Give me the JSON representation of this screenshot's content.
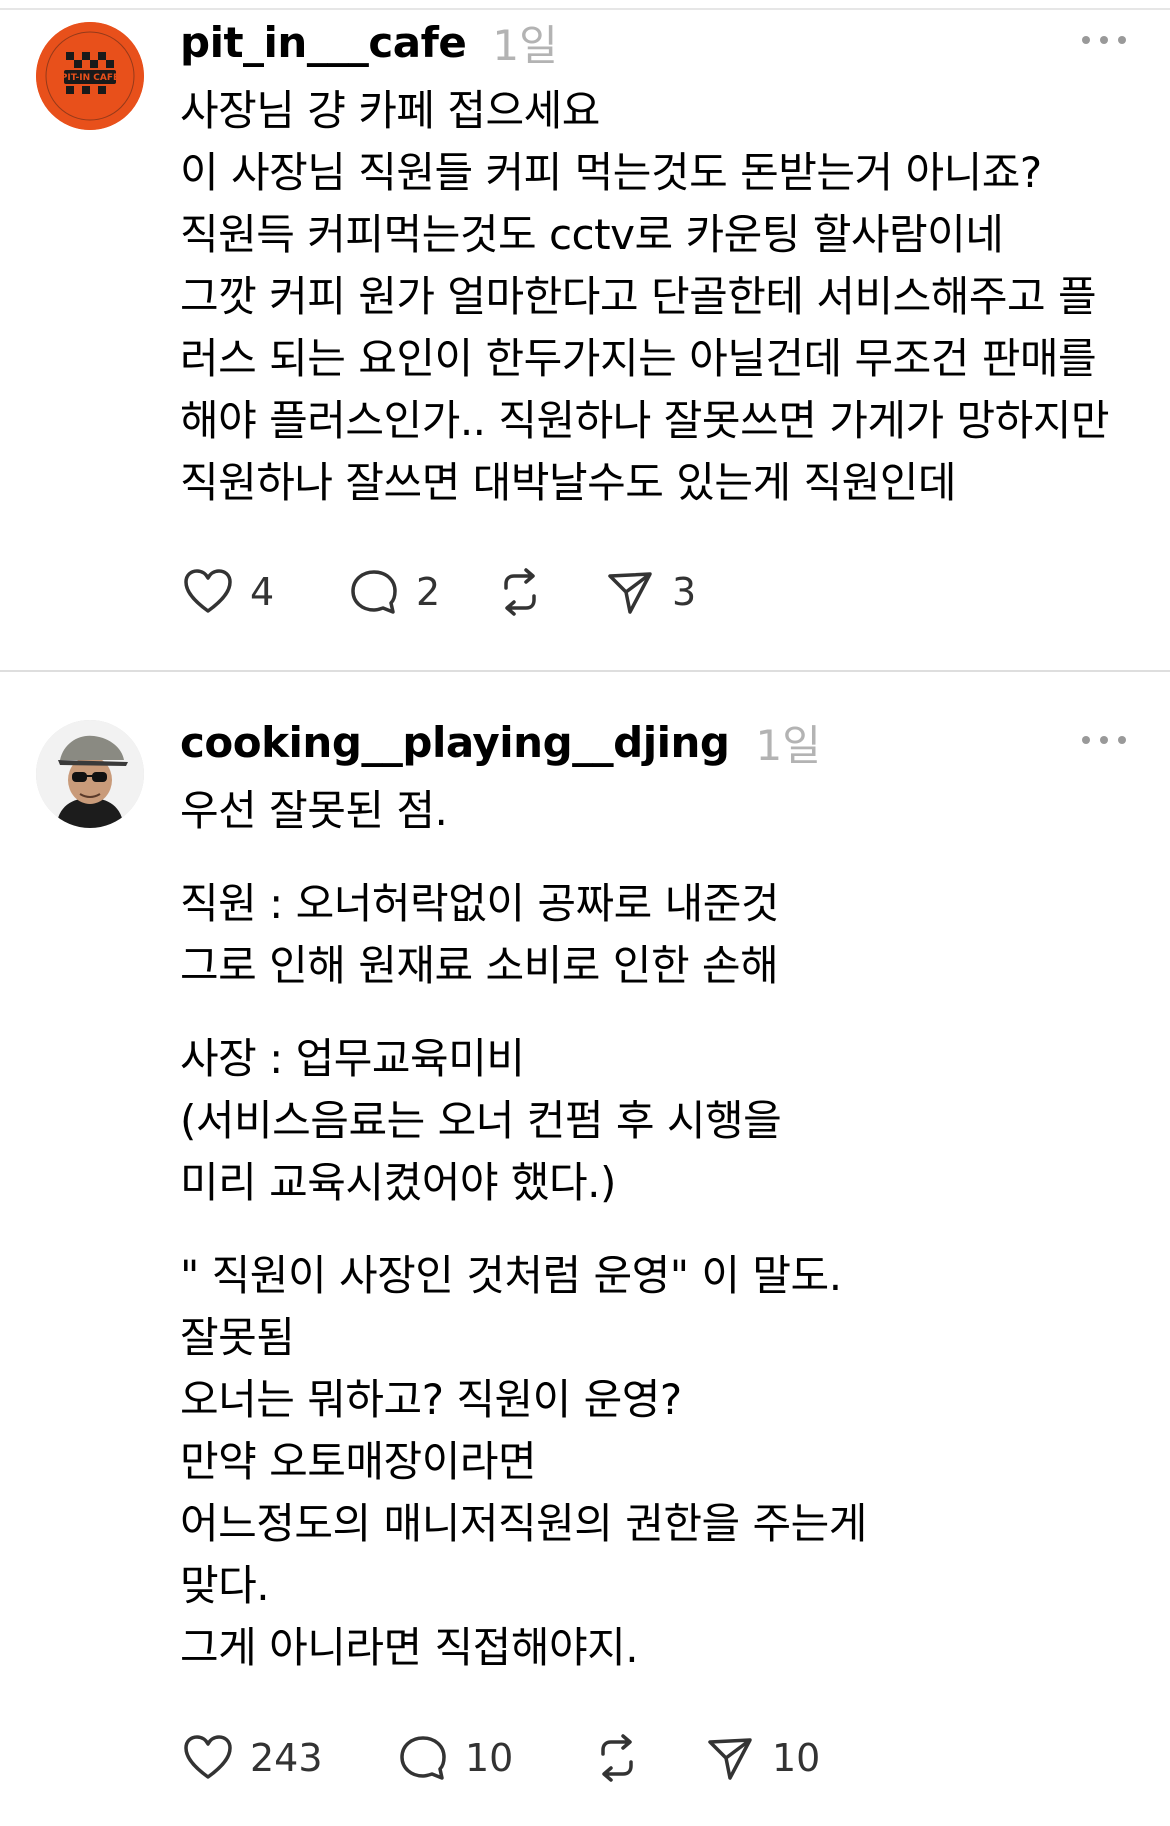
{
  "posts": [
    {
      "username": "pit_in___cafe",
      "time": "1일",
      "avatar_text": "PIT-IN CAFE",
      "lines": [
        "사장님 걍 카페 접으세요",
        "이 사장님 직원들 커피 먹는것도 돈받는거 아니죠?",
        "직원득 커피먹는것도 cctv로 카운팅 할사람이네",
        "그깟 커피 원가 얼마한다고 단골한테 서비스해주고 플",
        "러스 되는 요인이 한두가지는 아닐건데 무조건 판매를",
        "해야 플러스인가.. 직원하나 잘못쓰면 가게가 망하지만",
        "직원하나 잘쓰면 대박날수도 있는게 직원인데"
      ],
      "likes": "4",
      "comments": "2",
      "shares": "3"
    },
    {
      "username": "cooking__playing__djing",
      "time": "1일",
      "paragraphs": [
        [
          "우선 잘못된 점."
        ],
        [
          "직원 : 오너허락없이 공짜로 내준것",
          "그로 인해 원재료 소비로 인한 손해"
        ],
        [
          "사장 : 업무교육미비",
          "(서비스음료는 오너 컨펌 후 시행을",
          "미리 교육시켰어야 했다.)"
        ],
        [
          "\" 직원이 사장인 것처럼 운영\" 이 말도.",
          "잘못됨",
          "오너는 뭐하고? 직원이 운영?",
          "만약 오토매장이라면",
          "어느정도의 매니저직원의 권한을 주는게",
          "맞다.",
          "그게 아니라면 직접해야지."
        ]
      ],
      "likes": "243",
      "comments": "10",
      "shares": "10"
    }
  ]
}
